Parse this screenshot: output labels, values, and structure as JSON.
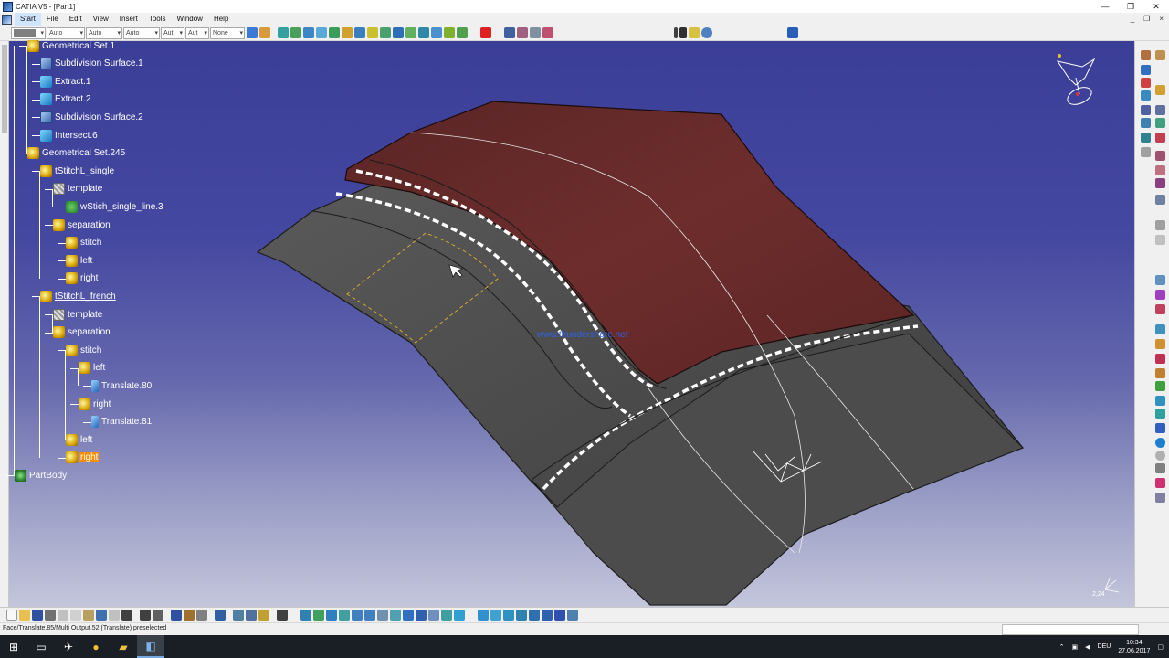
{
  "window": {
    "title": "CATIA V5 - [Part1]",
    "controls": [
      "—",
      "❐",
      "✕"
    ]
  },
  "menu": {
    "items": [
      "Start",
      "File",
      "Edit",
      "View",
      "Insert",
      "Tools",
      "Window",
      "Help"
    ],
    "mdi_controls": [
      "_",
      "❐",
      "×"
    ]
  },
  "toolbar": {
    "combos": [
      "Auto",
      "Auto",
      "Auto",
      "Aut",
      "Aut",
      "None"
    ]
  },
  "tree": {
    "nodes": [
      {
        "label": "Geometrical Set.1",
        "icon": "geometrical-set-icon"
      },
      {
        "label": "Subdivision Surface.1",
        "icon": "subdivision-surface-icon"
      },
      {
        "label": "Extract.1",
        "icon": "extract-icon"
      },
      {
        "label": "Extract.2",
        "icon": "extract-icon"
      },
      {
        "label": "Subdivision Surface.2",
        "icon": "subdivision-surface-icon"
      },
      {
        "label": "Intersect.6",
        "icon": "intersect-icon"
      },
      {
        "label": "Geometrical Set.245",
        "icon": "geometrical-set-icon"
      },
      {
        "label": "tStitchL_single",
        "icon": "geometrical-set-icon"
      },
      {
        "label": "template",
        "icon": "template-icon"
      },
      {
        "label": "wStich_single_line.3",
        "icon": "stitch-feature-icon"
      },
      {
        "label": "separation",
        "icon": "geometrical-set-icon"
      },
      {
        "label": "stitch",
        "icon": "geometrical-set-icon"
      },
      {
        "label": "left",
        "icon": "geometrical-set-icon"
      },
      {
        "label": "right",
        "icon": "geometrical-set-icon"
      },
      {
        "label": "tStitchL_french",
        "icon": "geometrical-set-icon"
      },
      {
        "label": "template",
        "icon": "template-icon"
      },
      {
        "label": "separation",
        "icon": "geometrical-set-icon"
      },
      {
        "label": "stitch",
        "icon": "geometrical-set-icon"
      },
      {
        "label": "left",
        "icon": "geometrical-set-icon"
      },
      {
        "label": "Translate.80",
        "icon": "translate-icon"
      },
      {
        "label": "right",
        "icon": "geometrical-set-icon"
      },
      {
        "label": "Translate.81",
        "icon": "translate-icon"
      },
      {
        "label": "left",
        "icon": "geometrical-set-icon"
      },
      {
        "label": "right",
        "icon": "geometrical-set-icon"
      },
      {
        "label": "PartBody",
        "icon": "part-body-icon"
      }
    ],
    "selected": "right"
  },
  "viewport": {
    "watermark": "www.thundershare.net",
    "scale_label": "2,24",
    "background_top": "#3b3e97",
    "background_bottom": "#c4c6dc",
    "leather_color": "#6e2d2d",
    "surface_color": "#4b4b4b"
  },
  "status": {
    "text": "Face/Translate.85/Multi Output.52 (Translate) preselected"
  },
  "taskbar": {
    "time": "10:34",
    "date": "27.06.2017",
    "language": "DEU"
  },
  "colors": {
    "selection": "#ff8c00",
    "accent": "#0078d7"
  }
}
